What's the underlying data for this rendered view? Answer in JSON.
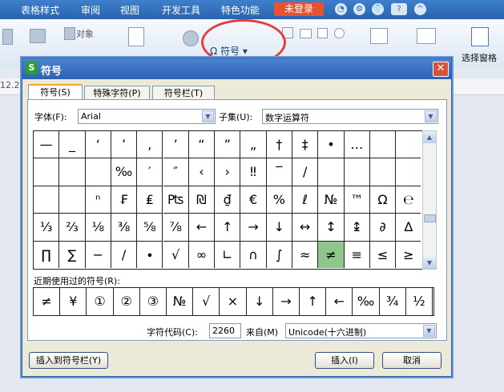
{
  "ribbon": {
    "menu": [
      "表格样式",
      "审阅",
      "视图",
      "开发工具",
      "特色功能"
    ],
    "login_label": "未登录",
    "help_label": "?",
    "toolbar_labels": {
      "object": "对象",
      "symbol": "符号",
      "select_pane": "选择窗格"
    },
    "doc_strip_value": "12.2"
  },
  "dialog": {
    "title": "符号",
    "app_icon_letter": "S",
    "close_glyph": "✕",
    "tabs": [
      "符号(S)",
      "特殊字符(P)",
      "符号栏(T)"
    ],
    "font_label": "字体(F):",
    "font_value": "Arial",
    "subset_label": "子集(U):",
    "subset_value": "数字运算符",
    "symbols": [
      [
        "—",
        "_",
        "‘",
        "’",
        ",",
        "’",
        "“",
        "”",
        "„",
        "†",
        "‡",
        "•",
        "…",
        "",
        "",
        ""
      ],
      [
        "",
        "",
        "",
        "‰",
        "′",
        "″",
        "‹",
        "›",
        "‼",
        "‾",
        "/",
        "",
        "",
        "",
        "",
        ""
      ],
      [
        "",
        "",
        "ⁿ",
        "₣",
        "₤",
        "₧",
        "₪",
        "₫",
        "€",
        "%",
        "ℓ",
        "№",
        "™",
        "Ω",
        "℮",
        ""
      ],
      [
        "⅓",
        "⅔",
        "⅛",
        "⅜",
        "⅝",
        "⅞",
        "←",
        "↑",
        "→",
        "↓",
        "↔",
        "↕",
        "↨",
        "∂",
        "∆",
        ""
      ],
      [
        "∏",
        "∑",
        "−",
        "∕",
        "∙",
        "√",
        "∞",
        "∟",
        "∩",
        "∫",
        "≈",
        "≠",
        "≡",
        "≤",
        "≥",
        ""
      ]
    ],
    "selected_symbol": "≠",
    "recent_label": "近期使用过的符号(R):",
    "recent": [
      "≠",
      "¥",
      "①",
      "②",
      "③",
      "№",
      "√",
      "×",
      "↓",
      "→",
      "↑",
      "←",
      "‰",
      "¾",
      "½",
      ""
    ],
    "charcode_label": "字符代码(C):",
    "charcode_value": "2260",
    "from_label": "来自(M)",
    "from_value": "Unicode(十六进制)",
    "insert_to_bar_label": "插入到符号栏(Y)",
    "insert_label": "插入(I)",
    "cancel_label": "取消"
  }
}
